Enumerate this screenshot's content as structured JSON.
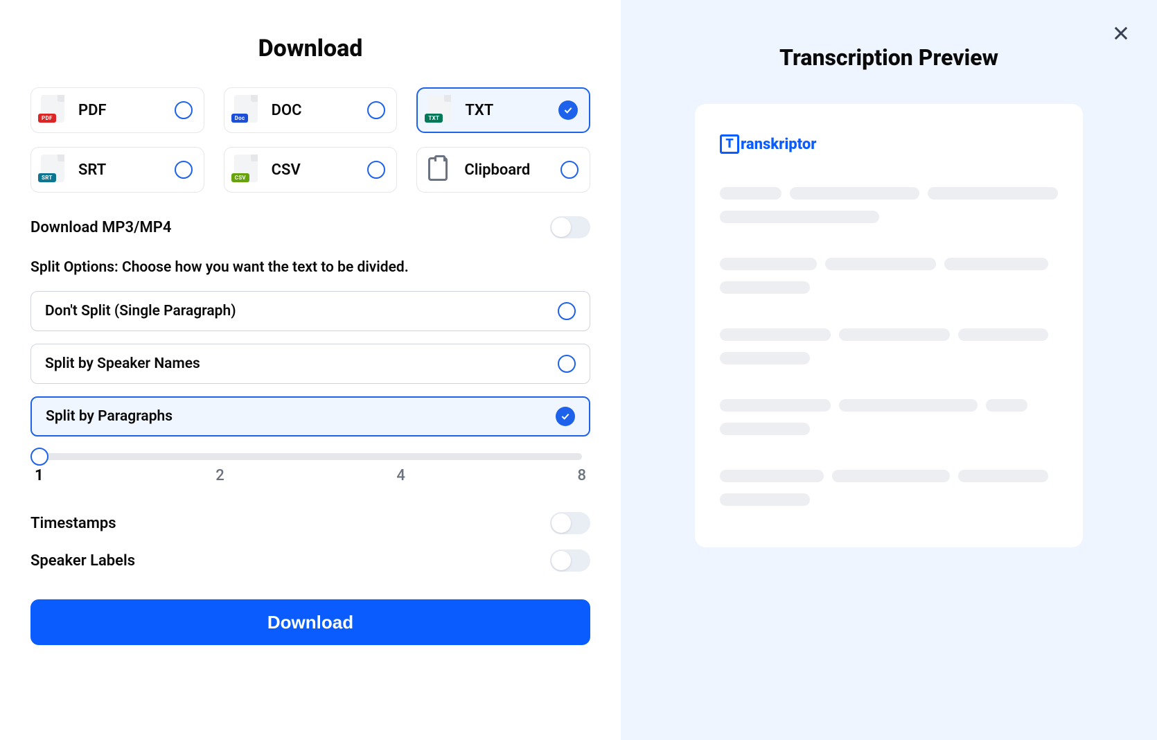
{
  "left": {
    "title": "Download",
    "formats": [
      {
        "label": "PDF",
        "badge": "PDF",
        "badgeCls": "badge-pdf",
        "selected": false
      },
      {
        "label": "DOC",
        "badge": "Doc",
        "badgeCls": "badge-doc",
        "selected": false
      },
      {
        "label": "TXT",
        "badge": "TXT",
        "badgeCls": "badge-txt",
        "selected": true
      },
      {
        "label": "SRT",
        "badge": "SRT",
        "badgeCls": "badge-srt",
        "selected": false
      },
      {
        "label": "CSV",
        "badge": "CSV",
        "badgeCls": "badge-csv",
        "selected": false
      },
      {
        "label": "Clipboard",
        "badge": null,
        "badgeCls": null,
        "selected": false
      }
    ],
    "mp3_label": "Download MP3/MP4",
    "mp3_on": false,
    "split_heading": "Split Options: Choose how you want the text to be divided.",
    "split_options": [
      {
        "label": "Don't Split (Single Paragraph)",
        "selected": false
      },
      {
        "label": "Split by Speaker Names",
        "selected": false
      },
      {
        "label": "Split by Paragraphs",
        "selected": true
      }
    ],
    "slider": {
      "value": 1,
      "ticks": [
        "1",
        "2",
        "4",
        "8"
      ]
    },
    "timestamps_label": "Timestamps",
    "timestamps_on": false,
    "speakers_label": "Speaker Labels",
    "speakers_on": false,
    "download_btn": "Download"
  },
  "right": {
    "title": "Transcription Preview",
    "brand": "ranskriptor",
    "brand_t": "T"
  }
}
